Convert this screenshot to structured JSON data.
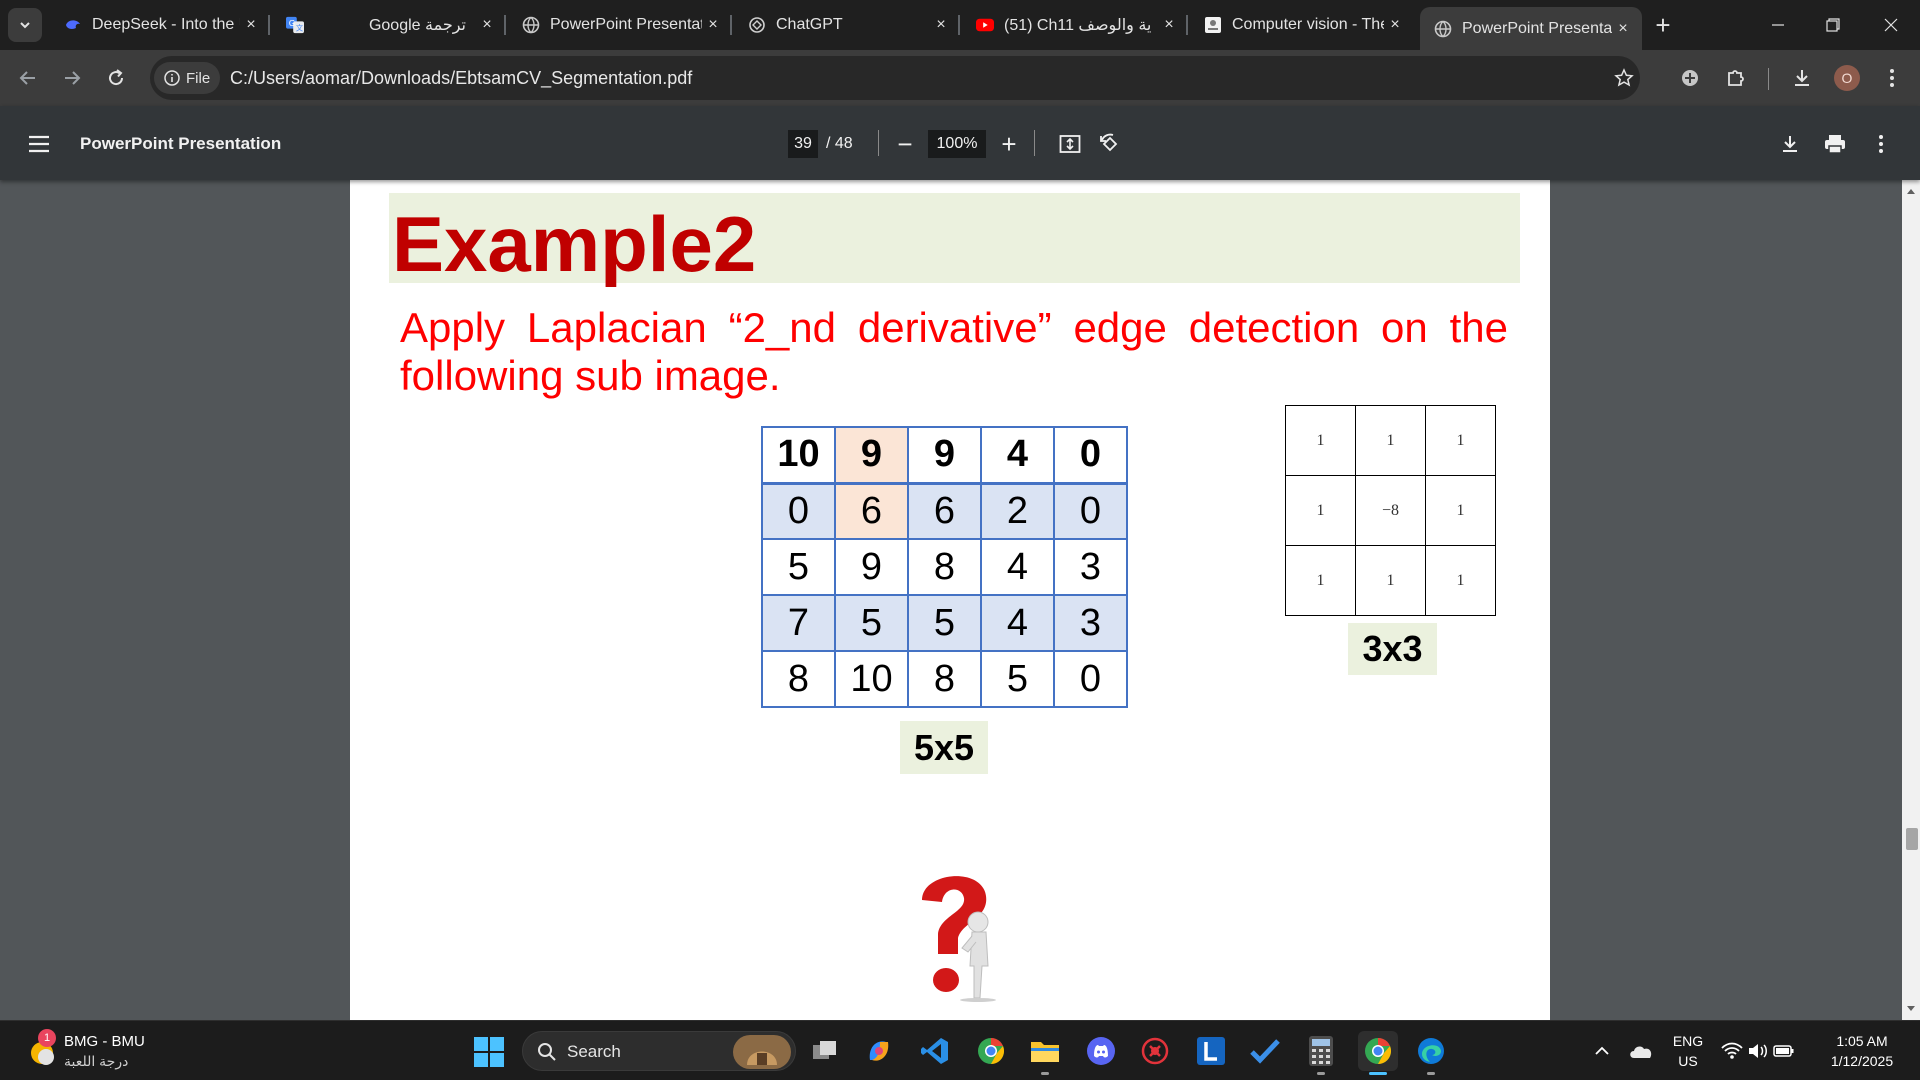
{
  "browser": {
    "tabs": [
      {
        "title": "DeepSeek - Into the Unknown",
        "favicon": "deepseek-icon",
        "close": "×"
      },
      {
        "title": "",
        "favicon": "translate-icon"
      },
      {
        "title": "Google ترجمة",
        "favicon": "none",
        "close": "×"
      },
      {
        "title": "PowerPoint Presentation",
        "favicon": "globe-icon",
        "close": "×"
      },
      {
        "title": "ChatGPT",
        "favicon": "chatgpt-icon",
        "close": "×"
      },
      {
        "title": "(51) Ch11 ية والوصف",
        "favicon": "youtube-icon",
        "close": "×"
      },
      {
        "title": "Computer vision - The",
        "favicon": "doc-icon",
        "close": "×"
      },
      {
        "title": "PowerPoint Presentation",
        "favicon": "globe-icon",
        "close": "×",
        "active": true
      }
    ],
    "new_tab": "+",
    "address": {
      "chip_label": "File",
      "url": "C:/Users/aomar/Downloads/EbtsamCV_Segmentation.pdf"
    },
    "profile_initial": "O",
    "colors": {
      "tabstrip": "#1f1f1f",
      "toolbar": "#3c3c3c",
      "omnibox": "#282828"
    }
  },
  "pdf_viewer": {
    "title": "PowerPoint Presentation",
    "current_page": "39",
    "total_pages": "/ 48",
    "zoom": "100%",
    "zoom_out": "−",
    "zoom_in": "+"
  },
  "slide": {
    "title": "Example2",
    "instruction": "Apply Laplacian “2_nd derivative” edge detection on the following sub image.",
    "image_matrix": {
      "rows": [
        [
          "10",
          "9",
          "9",
          "4",
          "0"
        ],
        [
          "0",
          "6",
          "6",
          "2",
          "0"
        ],
        [
          "5",
          "9",
          "8",
          "4",
          "3"
        ],
        [
          "7",
          "5",
          "5",
          "4",
          "3"
        ],
        [
          "8",
          "10",
          "8",
          "5",
          "0"
        ]
      ],
      "highlighted_column": 1,
      "label": "5x5"
    },
    "kernel": {
      "rows": [
        [
          "1",
          "1",
          "1"
        ],
        [
          "1",
          "−8",
          "1"
        ],
        [
          "1",
          "1",
          "1"
        ]
      ],
      "label": "3x3"
    },
    "colors": {
      "title": "#c00000",
      "instruction": "#ff0000",
      "label_bg": "#ebf1de",
      "grid_border": "#4472c4",
      "band": "#dae3f3",
      "highlight": "#fbe5d6"
    }
  },
  "taskbar": {
    "weather_badge": "1",
    "weather_line1": "BMG - BMU",
    "weather_line2": "درجة اللعبة",
    "search_label": "Search",
    "apps": [
      "widgets-icon",
      "task-view-icon",
      "copilot-icon",
      "vscode-icon",
      "chrome-icon",
      "file-explorer-icon",
      "discord-icon",
      "app-red-icon",
      "l-app-icon",
      "todo-icon",
      "calculator-icon",
      "chrome-active-icon",
      "edge-icon"
    ],
    "tray": {
      "lang_line1": "ENG",
      "lang_line2": "US",
      "time": "1:05 AM",
      "date": "1/12/2025"
    }
  }
}
